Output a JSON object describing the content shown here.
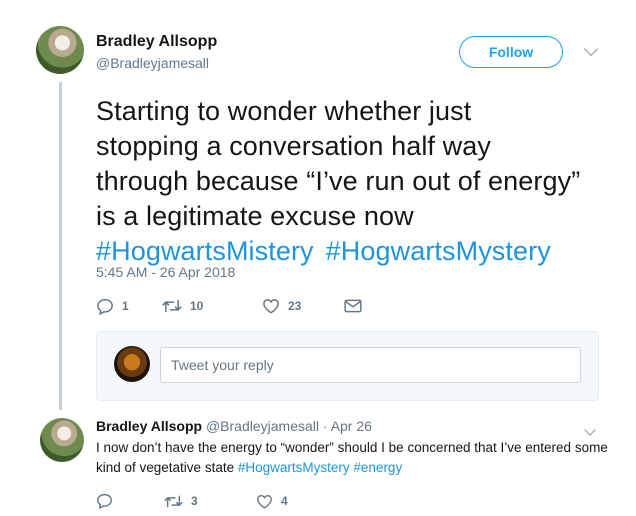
{
  "tweet": {
    "author_name": "Bradley Allsopp",
    "author_handle": "@Bradleyjamesall",
    "follow_label": "Follow",
    "text_lines": [
      "Starting to wonder whether just",
      "stopping a conversation half way",
      "through because “I’ve run out of energy”",
      "is a legitimate excuse now"
    ],
    "hashtags": [
      "#HogwartsMistery",
      "#HogwartsMystery"
    ],
    "timestamp": "5:45 AM - 26 Apr 2018",
    "replies": "1",
    "retweets": "10",
    "likes": "23",
    "icons": {
      "reply": "reply-icon",
      "retweet": "retweet-icon",
      "like": "heart-icon",
      "dm": "envelope-icon",
      "more": "chevron-down-icon"
    }
  },
  "reply_box": {
    "placeholder": "Tweet your reply"
  },
  "reply_tweet": {
    "author_name": "Bradley Allsopp",
    "author_handle": "@Bradleyjamesall",
    "separator": "·",
    "date": "Apr 26",
    "text_part1": "I now don’t have the energy to “wonder” should I be concerned that I’ve entered",
    "text_part2": "some kind of vegetative state",
    "tag1": "#HogwartsMystery",
    "tag2": "#energy",
    "replies": "",
    "retweets": "3",
    "likes": "4"
  },
  "colors": {
    "link": "#1b95e0",
    "follow": "#1da1f2",
    "muted": "#657786"
  }
}
